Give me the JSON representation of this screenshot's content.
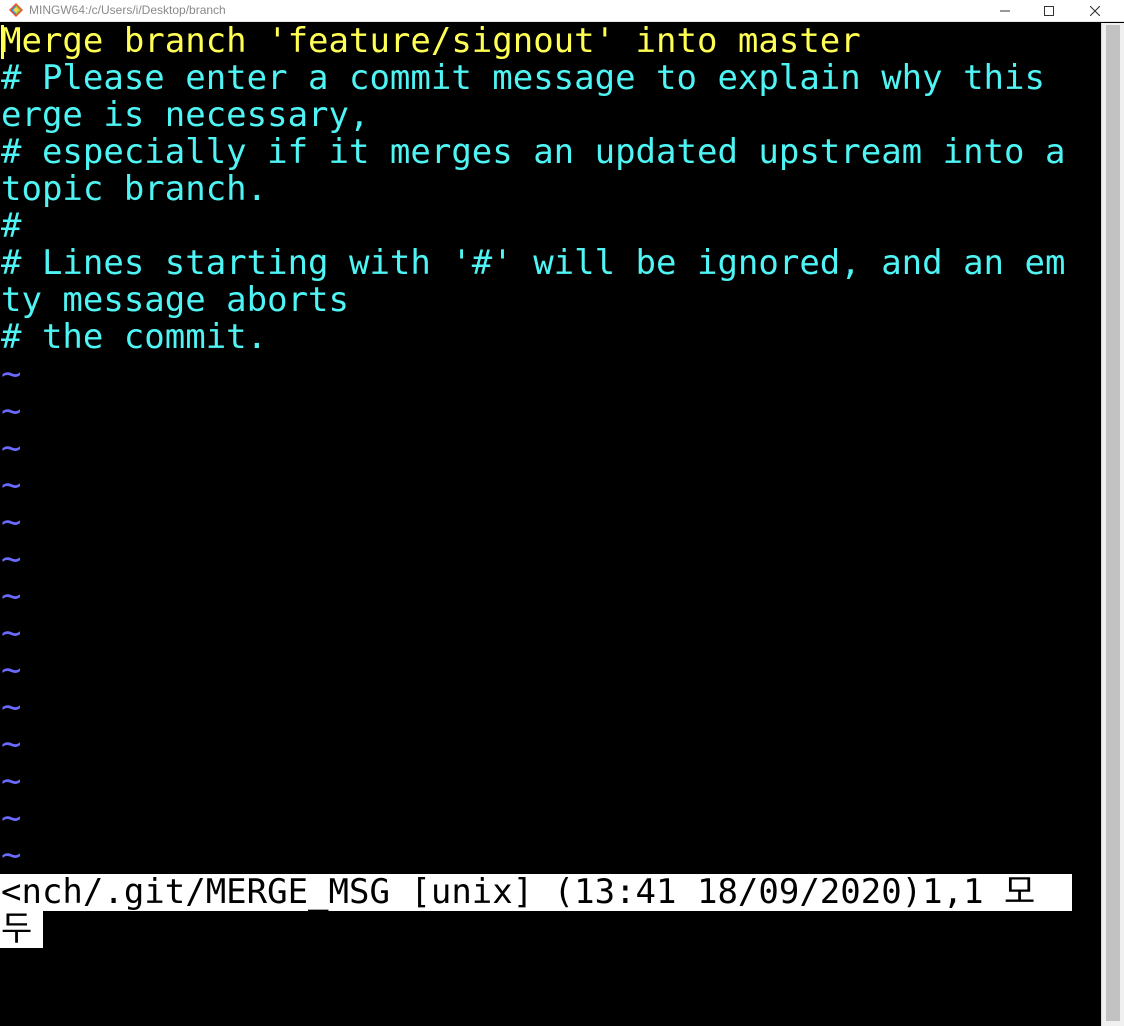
{
  "window": {
    "title": "MINGW64:/c/Users/i/Desktop/branch",
    "icon": "git-bash-icon",
    "controls": [
      "minimize-icon",
      "maximize-icon",
      "close-icon"
    ]
  },
  "editor": {
    "lines": [
      {
        "text": "Merge branch 'feature/signout' into master",
        "color": "#ffff54"
      },
      {
        "text": "# Please enter a commit message to explain why this",
        "color": "#4ff4f4"
      },
      {
        "text": "erge is necessary,",
        "color": "#4ff4f4"
      },
      {
        "text": "# especially if it merges an updated upstream into a",
        "color": "#4ff4f4"
      },
      {
        "text": "topic branch.",
        "color": "#4ff4f4"
      },
      {
        "text": "#",
        "color": "#4ff4f4"
      },
      {
        "text": "# Lines starting with '#' will be ignored, and an em",
        "color": "#4ff4f4"
      },
      {
        "text": "ty message aborts",
        "color": "#4ff4f4"
      },
      {
        "text": "# the commit.",
        "color": "#4ff4f4"
      }
    ],
    "empty_line_marker": "~",
    "empty_line_count": 14,
    "tilde_color": "#6a6aff"
  },
  "statusline": {
    "line1": "<nch/.git/MERGE_MSG [unix] (13:41 18/09/2020)1,1 모",
    "line2": "두"
  }
}
